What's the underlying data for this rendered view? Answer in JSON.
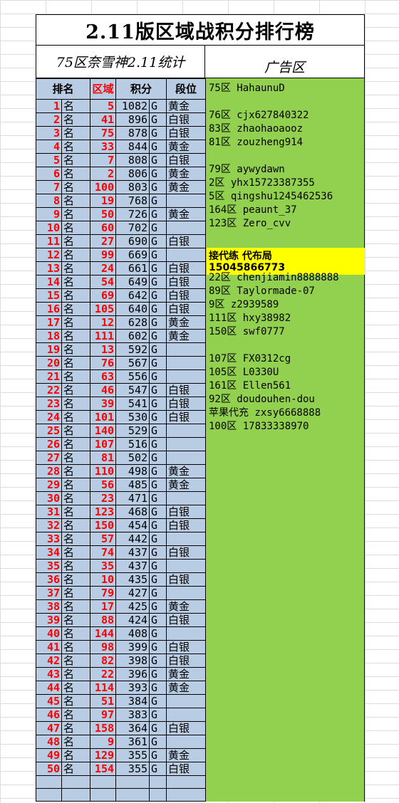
{
  "title": "2.11版区域战积分排行榜",
  "subtitle": "75区奈雪神2.11统计",
  "ad_title": "广告区",
  "headers": [
    "排名",
    "区域",
    "积分",
    "段位"
  ],
  "rankings": [
    {
      "rank": "1",
      "ming": "名",
      "zone": "5",
      "score": "1082",
      "unit": "G",
      "tier": "黄金"
    },
    {
      "rank": "2",
      "ming": "名",
      "zone": "41",
      "score": "896",
      "unit": "G",
      "tier": "白银"
    },
    {
      "rank": "3",
      "ming": "名",
      "zone": "75",
      "score": "878",
      "unit": "G",
      "tier": "白银"
    },
    {
      "rank": "4",
      "ming": "名",
      "zone": "33",
      "score": "844",
      "unit": "G",
      "tier": "黄金"
    },
    {
      "rank": "5",
      "ming": "名",
      "zone": "7",
      "score": "808",
      "unit": "G",
      "tier": "白银"
    },
    {
      "rank": "6",
      "ming": "名",
      "zone": "2",
      "score": "806",
      "unit": "G",
      "tier": "黄金"
    },
    {
      "rank": "7",
      "ming": "名",
      "zone": "100",
      "score": "803",
      "unit": "G",
      "tier": "黄金"
    },
    {
      "rank": "8",
      "ming": "名",
      "zone": "19",
      "score": "768",
      "unit": "G",
      "tier": ""
    },
    {
      "rank": "9",
      "ming": "名",
      "zone": "50",
      "score": "726",
      "unit": "G",
      "tier": "黄金"
    },
    {
      "rank": "10",
      "ming": "名",
      "zone": "60",
      "score": "702",
      "unit": "G",
      "tier": ""
    },
    {
      "rank": "11",
      "ming": "名",
      "zone": "27",
      "score": "690",
      "unit": "G",
      "tier": "白银"
    },
    {
      "rank": "12",
      "ming": "名",
      "zone": "99",
      "score": "669",
      "unit": "G",
      "tier": ""
    },
    {
      "rank": "13",
      "ming": "名",
      "zone": "24",
      "score": "661",
      "unit": "G",
      "tier": "白银"
    },
    {
      "rank": "14",
      "ming": "名",
      "zone": "54",
      "score": "649",
      "unit": "G",
      "tier": "白银"
    },
    {
      "rank": "15",
      "ming": "名",
      "zone": "69",
      "score": "642",
      "unit": "G",
      "tier": "白银"
    },
    {
      "rank": "16",
      "ming": "名",
      "zone": "105",
      "score": "640",
      "unit": "G",
      "tier": "白银"
    },
    {
      "rank": "17",
      "ming": "名",
      "zone": "12",
      "score": "628",
      "unit": "G",
      "tier": "黄金"
    },
    {
      "rank": "18",
      "ming": "名",
      "zone": "111",
      "score": "602",
      "unit": "G",
      "tier": "黄金"
    },
    {
      "rank": "19",
      "ming": "名",
      "zone": "13",
      "score": "592",
      "unit": "G",
      "tier": ""
    },
    {
      "rank": "20",
      "ming": "名",
      "zone": "76",
      "score": "567",
      "unit": "G",
      "tier": ""
    },
    {
      "rank": "21",
      "ming": "名",
      "zone": "63",
      "score": "556",
      "unit": "G",
      "tier": ""
    },
    {
      "rank": "22",
      "ming": "名",
      "zone": "46",
      "score": "547",
      "unit": "G",
      "tier": "白银"
    },
    {
      "rank": "23",
      "ming": "名",
      "zone": "39",
      "score": "541",
      "unit": "G",
      "tier": "白银"
    },
    {
      "rank": "24",
      "ming": "名",
      "zone": "101",
      "score": "530",
      "unit": "G",
      "tier": "白银"
    },
    {
      "rank": "25",
      "ming": "名",
      "zone": "140",
      "score": "529",
      "unit": "G",
      "tier": ""
    },
    {
      "rank": "26",
      "ming": "名",
      "zone": "107",
      "score": "516",
      "unit": "G",
      "tier": ""
    },
    {
      "rank": "27",
      "ming": "名",
      "zone": "81",
      "score": "502",
      "unit": "G",
      "tier": ""
    },
    {
      "rank": "28",
      "ming": "名",
      "zone": "110",
      "score": "498",
      "unit": "G",
      "tier": "黄金"
    },
    {
      "rank": "29",
      "ming": "名",
      "zone": "56",
      "score": "485",
      "unit": "G",
      "tier": "黄金"
    },
    {
      "rank": "30",
      "ming": "名",
      "zone": "23",
      "score": "471",
      "unit": "G",
      "tier": ""
    },
    {
      "rank": "31",
      "ming": "名",
      "zone": "123",
      "score": "468",
      "unit": "G",
      "tier": "白银"
    },
    {
      "rank": "32",
      "ming": "名",
      "zone": "150",
      "score": "454",
      "unit": "G",
      "tier": "白银"
    },
    {
      "rank": "33",
      "ming": "名",
      "zone": "57",
      "score": "442",
      "unit": "G",
      "tier": ""
    },
    {
      "rank": "34",
      "ming": "名",
      "zone": "74",
      "score": "437",
      "unit": "G",
      "tier": "白银"
    },
    {
      "rank": "35",
      "ming": "名",
      "zone": "35",
      "score": "437",
      "unit": "G",
      "tier": ""
    },
    {
      "rank": "36",
      "ming": "名",
      "zone": "10",
      "score": "435",
      "unit": "G",
      "tier": "白银"
    },
    {
      "rank": "37",
      "ming": "名",
      "zone": "79",
      "score": "427",
      "unit": "G",
      "tier": ""
    },
    {
      "rank": "38",
      "ming": "名",
      "zone": "17",
      "score": "425",
      "unit": "G",
      "tier": "黄金"
    },
    {
      "rank": "39",
      "ming": "名",
      "zone": "88",
      "score": "424",
      "unit": "G",
      "tier": "白银"
    },
    {
      "rank": "40",
      "ming": "名",
      "zone": "144",
      "score": "408",
      "unit": "G",
      "tier": ""
    },
    {
      "rank": "41",
      "ming": "名",
      "zone": "98",
      "score": "399",
      "unit": "G",
      "tier": "白银"
    },
    {
      "rank": "42",
      "ming": "名",
      "zone": "82",
      "score": "398",
      "unit": "G",
      "tier": "白银"
    },
    {
      "rank": "43",
      "ming": "名",
      "zone": "22",
      "score": "396",
      "unit": "G",
      "tier": "黄金"
    },
    {
      "rank": "44",
      "ming": "名",
      "zone": "114",
      "score": "393",
      "unit": "G",
      "tier": "黄金"
    },
    {
      "rank": "45",
      "ming": "名",
      "zone": "51",
      "score": "384",
      "unit": "G",
      "tier": ""
    },
    {
      "rank": "46",
      "ming": "名",
      "zone": "97",
      "score": "383",
      "unit": "G",
      "tier": ""
    },
    {
      "rank": "47",
      "ming": "名",
      "zone": "158",
      "score": "364",
      "unit": "G",
      "tier": "白银"
    },
    {
      "rank": "48",
      "ming": "名",
      "zone": "9",
      "score": "361",
      "unit": "G",
      "tier": ""
    },
    {
      "rank": "49",
      "ming": "名",
      "zone": "129",
      "score": "355",
      "unit": "G",
      "tier": "黄金"
    },
    {
      "rank": "50",
      "ming": "名",
      "zone": "154",
      "score": "355",
      "unit": "G",
      "tier": "白银"
    }
  ],
  "ads": [
    {
      "text": "75区  HahaunuD",
      "row": 0
    },
    {
      "text": "76区  cjx627840322",
      "row": 2
    },
    {
      "text": "83区  zhaohaoaooz",
      "row": 3
    },
    {
      "text": "81区  zouzheng914",
      "row": 4
    },
    {
      "text": "79区  aywydawn",
      "row": 6
    },
    {
      "text": "2区  yhx15723387355",
      "row": 7
    },
    {
      "text": "5区  qingshu1245462536",
      "row": 8
    },
    {
      "text": "164区 peaunt_37",
      "row": 9
    },
    {
      "text": "123区 Zero_cvv",
      "row": 10
    },
    {
      "text": "22区  chenjiamin8888888",
      "row": 14
    },
    {
      "text": "89区  Taylormade-07",
      "row": 15
    },
    {
      "text": "9区  z2939589",
      "row": 16
    },
    {
      "text": "111区 hxy38982",
      "row": 17
    },
    {
      "text": "150区 swf0777",
      "row": 18
    },
    {
      "text": "107区 FX0312cg",
      "row": 20
    },
    {
      "text": "105区 L0330U",
      "row": 21
    },
    {
      "text": "161区 Ellen561",
      "row": 22
    },
    {
      "text": "92区  doudouhen-dou",
      "row": 23
    },
    {
      "text": "苹果代充  zxsy6668888",
      "row": 24
    },
    {
      "text": "100区  17833338970",
      "row": 25
    }
  ],
  "ad_highlight": {
    "line1": "接代练 代布局",
    "line2": "15045866773"
  },
  "colors": {
    "table_bg": "#b8cce4",
    "ad_bg": "#92d050",
    "highlight": "#ffff00",
    "accent_red": "#ff0000"
  }
}
